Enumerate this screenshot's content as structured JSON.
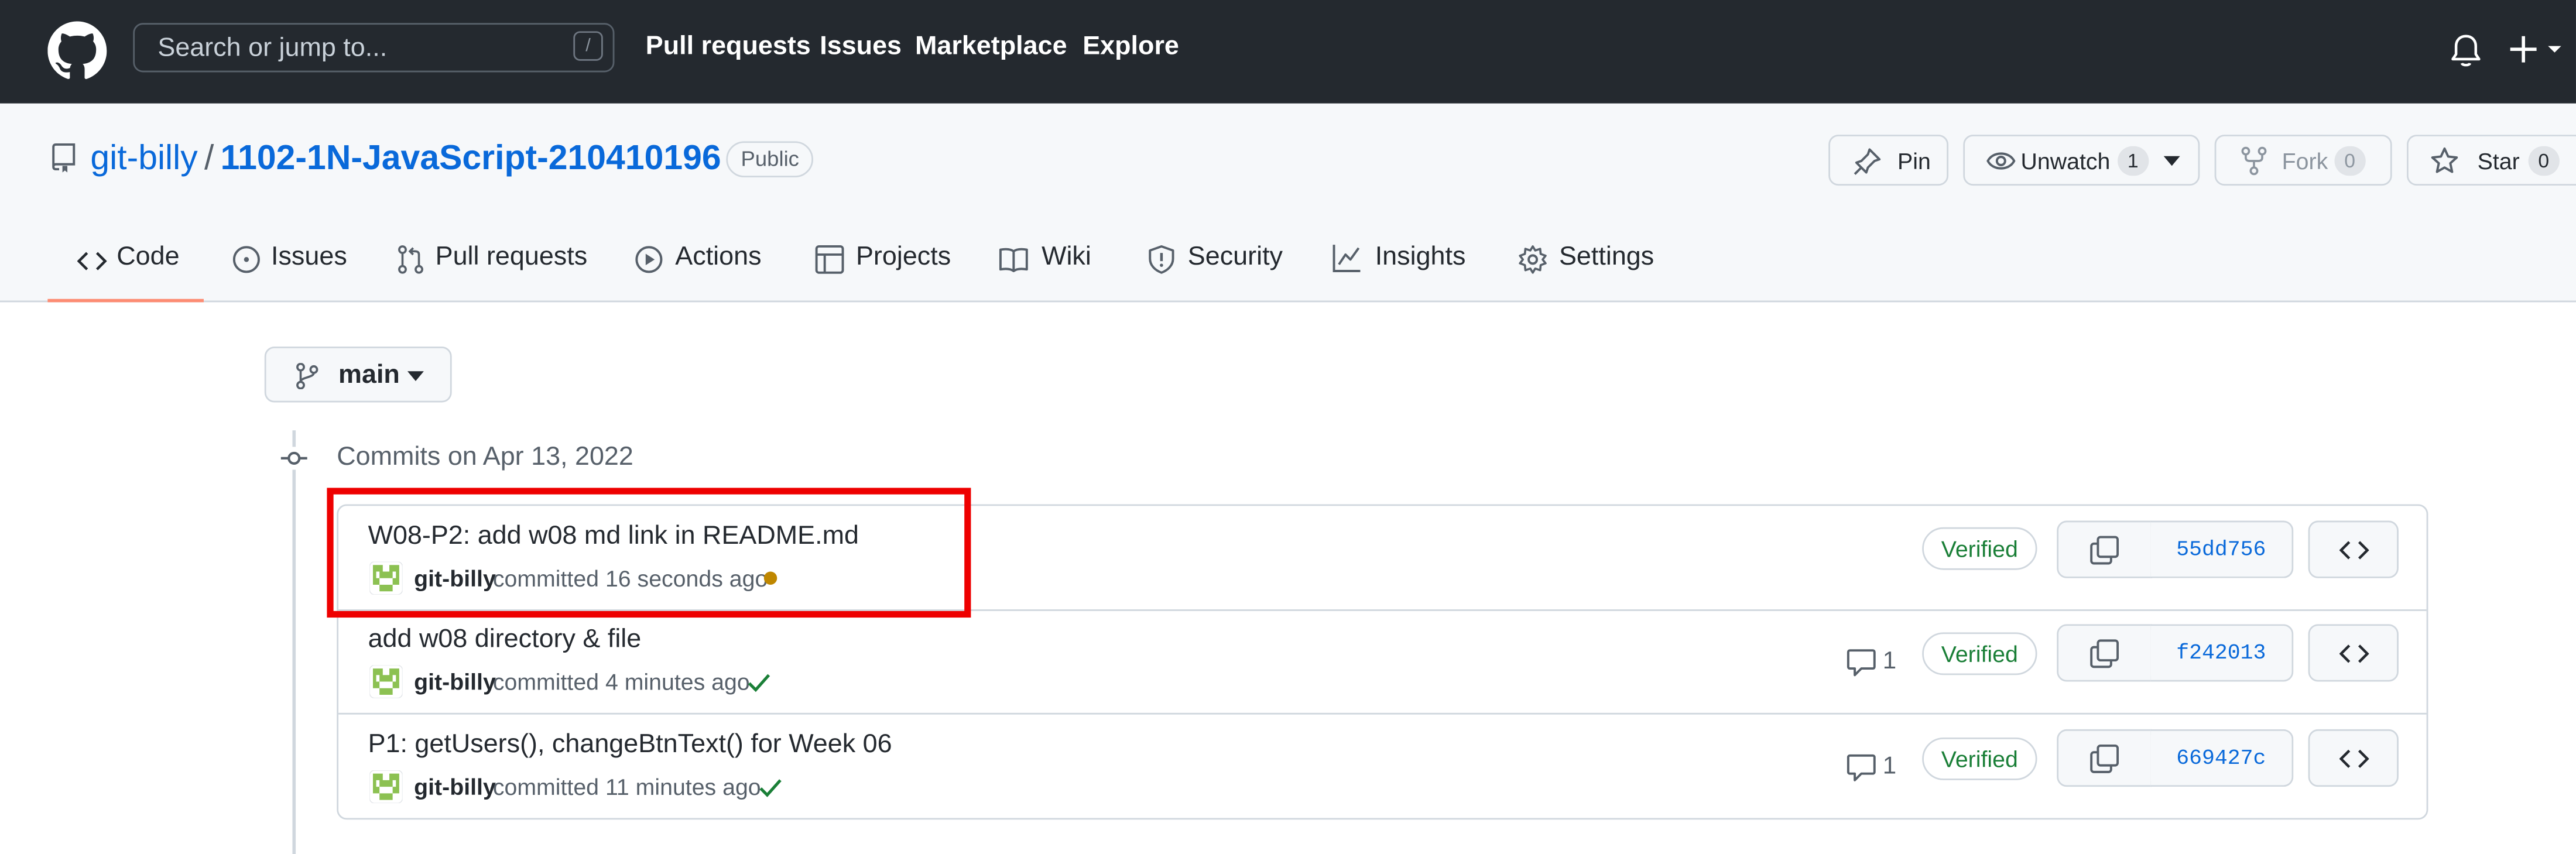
{
  "header": {
    "search_placeholder": "Search or jump to...",
    "search_shortcut": "/",
    "nav": [
      "Pull requests",
      "Issues",
      "Marketplace",
      "Explore"
    ]
  },
  "repo": {
    "owner": "git-billy",
    "separator": "/",
    "name": "1102-1N-JavaScript-210410196",
    "visibility": "Public",
    "actions": {
      "pin": "Pin",
      "unwatch": "Unwatch",
      "unwatch_count": "1",
      "fork": "Fork",
      "fork_count": "0",
      "star": "Star",
      "star_count": "0"
    }
  },
  "tabs": [
    "Code",
    "Issues",
    "Pull requests",
    "Actions",
    "Projects",
    "Wiki",
    "Security",
    "Insights",
    "Settings"
  ],
  "branch": "main",
  "commits_heading": "Commits on Apr 13, 2022",
  "commits": [
    {
      "title": "W08-P2: add w08 md link in README.md",
      "author": "git-billy",
      "meta": "committed 16 seconds ago",
      "status": "pending",
      "comments": "",
      "verified": "Verified",
      "sha": "55dd756"
    },
    {
      "title": "add w08 directory & file",
      "author": "git-billy",
      "meta": "committed 4 minutes ago",
      "status": "success",
      "comments": "1",
      "verified": "Verified",
      "sha": "f242013"
    },
    {
      "title": "P1: getUsers(), changeBtnText() for Week 06",
      "author": "git-billy",
      "meta": "committed 11 minutes ago",
      "status": "success",
      "comments": "1",
      "verified": "Verified",
      "sha": "669427c"
    }
  ],
  "colors": {
    "header_bg": "#24292f",
    "link": "#0969da",
    "verified": "#1a7f37",
    "pending": "#bf8700",
    "tab_underline": "#fd8c73",
    "highlight": "#ee0000"
  }
}
